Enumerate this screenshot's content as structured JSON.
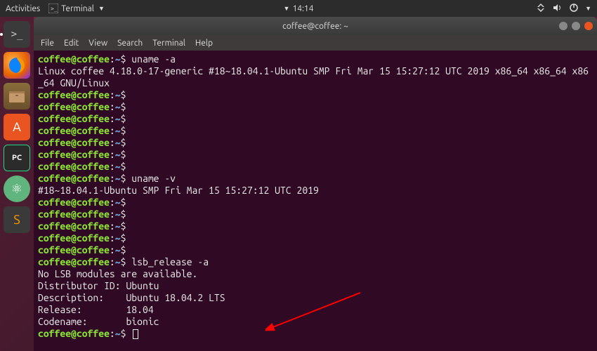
{
  "top_panel": {
    "activities": "Activities",
    "app_label": "Terminal",
    "clock": "14:14"
  },
  "launcher": {
    "items": [
      {
        "name": "terminal",
        "symbol": ">_"
      },
      {
        "name": "firefox",
        "symbol": ""
      },
      {
        "name": "files",
        "symbol": ""
      },
      {
        "name": "software",
        "symbol": "A"
      },
      {
        "name": "pycharm",
        "symbol": "PC"
      },
      {
        "name": "atom",
        "symbol": "⚛"
      },
      {
        "name": "sublime",
        "symbol": "S"
      }
    ]
  },
  "window": {
    "title": "coffee@coffee: ~",
    "menus": [
      "File",
      "Edit",
      "View",
      "Search",
      "Terminal",
      "Help"
    ]
  },
  "prompt": {
    "user_host": "coffee@coffee",
    "path": "~",
    "sep1": ":",
    "sep2": "$"
  },
  "lines": {
    "l0_cmd": "uname -a",
    "l1": "Linux coffee 4.18.0-17-generic #18~18.04.1-Ubuntu SMP Fri Mar 15 15:27:12 UTC 2019 x86_64 x86_64 x86_64 GNU/Linux",
    "l9_cmd": "uname -v",
    "l10": "#18~18.04.1-Ubuntu SMP Fri Mar 15 15:27:12 UTC 2019",
    "l16_cmd": "lsb_release -a",
    "l17": "No LSB modules are available.",
    "l18": "Distributor ID:\tUbuntu",
    "l19": "Description:\tUbuntu 18.04.2 LTS",
    "l20": "Release:\t18.04",
    "l21": "Codename:\tbionic"
  }
}
